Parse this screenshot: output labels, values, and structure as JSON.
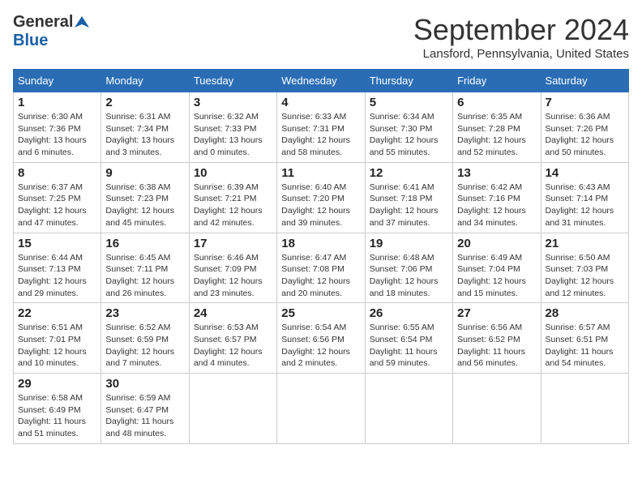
{
  "header": {
    "logo_general": "General",
    "logo_blue": "Blue",
    "month_title": "September 2024",
    "location": "Lansford, Pennsylvania, United States"
  },
  "calendar": {
    "days_of_week": [
      "Sunday",
      "Monday",
      "Tuesday",
      "Wednesday",
      "Thursday",
      "Friday",
      "Saturday"
    ],
    "weeks": [
      [
        {
          "day": "1",
          "sunrise": "6:30 AM",
          "sunset": "7:36 PM",
          "daylight": "13 hours and 6 minutes."
        },
        {
          "day": "2",
          "sunrise": "6:31 AM",
          "sunset": "7:34 PM",
          "daylight": "13 hours and 3 minutes."
        },
        {
          "day": "3",
          "sunrise": "6:32 AM",
          "sunset": "7:33 PM",
          "daylight": "13 hours and 0 minutes."
        },
        {
          "day": "4",
          "sunrise": "6:33 AM",
          "sunset": "7:31 PM",
          "daylight": "12 hours and 58 minutes."
        },
        {
          "day": "5",
          "sunrise": "6:34 AM",
          "sunset": "7:30 PM",
          "daylight": "12 hours and 55 minutes."
        },
        {
          "day": "6",
          "sunrise": "6:35 AM",
          "sunset": "7:28 PM",
          "daylight": "12 hours and 52 minutes."
        },
        {
          "day": "7",
          "sunrise": "6:36 AM",
          "sunset": "7:26 PM",
          "daylight": "12 hours and 50 minutes."
        }
      ],
      [
        {
          "day": "8",
          "sunrise": "6:37 AM",
          "sunset": "7:25 PM",
          "daylight": "12 hours and 47 minutes."
        },
        {
          "day": "9",
          "sunrise": "6:38 AM",
          "sunset": "7:23 PM",
          "daylight": "12 hours and 45 minutes."
        },
        {
          "day": "10",
          "sunrise": "6:39 AM",
          "sunset": "7:21 PM",
          "daylight": "12 hours and 42 minutes."
        },
        {
          "day": "11",
          "sunrise": "6:40 AM",
          "sunset": "7:20 PM",
          "daylight": "12 hours and 39 minutes."
        },
        {
          "day": "12",
          "sunrise": "6:41 AM",
          "sunset": "7:18 PM",
          "daylight": "12 hours and 37 minutes."
        },
        {
          "day": "13",
          "sunrise": "6:42 AM",
          "sunset": "7:16 PM",
          "daylight": "12 hours and 34 minutes."
        },
        {
          "day": "14",
          "sunrise": "6:43 AM",
          "sunset": "7:14 PM",
          "daylight": "12 hours and 31 minutes."
        }
      ],
      [
        {
          "day": "15",
          "sunrise": "6:44 AM",
          "sunset": "7:13 PM",
          "daylight": "12 hours and 29 minutes."
        },
        {
          "day": "16",
          "sunrise": "6:45 AM",
          "sunset": "7:11 PM",
          "daylight": "12 hours and 26 minutes."
        },
        {
          "day": "17",
          "sunrise": "6:46 AM",
          "sunset": "7:09 PM",
          "daylight": "12 hours and 23 minutes."
        },
        {
          "day": "18",
          "sunrise": "6:47 AM",
          "sunset": "7:08 PM",
          "daylight": "12 hours and 20 minutes."
        },
        {
          "day": "19",
          "sunrise": "6:48 AM",
          "sunset": "7:06 PM",
          "daylight": "12 hours and 18 minutes."
        },
        {
          "day": "20",
          "sunrise": "6:49 AM",
          "sunset": "7:04 PM",
          "daylight": "12 hours and 15 minutes."
        },
        {
          "day": "21",
          "sunrise": "6:50 AM",
          "sunset": "7:03 PM",
          "daylight": "12 hours and 12 minutes."
        }
      ],
      [
        {
          "day": "22",
          "sunrise": "6:51 AM",
          "sunset": "7:01 PM",
          "daylight": "12 hours and 10 minutes."
        },
        {
          "day": "23",
          "sunrise": "6:52 AM",
          "sunset": "6:59 PM",
          "daylight": "12 hours and 7 minutes."
        },
        {
          "day": "24",
          "sunrise": "6:53 AM",
          "sunset": "6:57 PM",
          "daylight": "12 hours and 4 minutes."
        },
        {
          "day": "25",
          "sunrise": "6:54 AM",
          "sunset": "6:56 PM",
          "daylight": "12 hours and 2 minutes."
        },
        {
          "day": "26",
          "sunrise": "6:55 AM",
          "sunset": "6:54 PM",
          "daylight": "11 hours and 59 minutes."
        },
        {
          "day": "27",
          "sunrise": "6:56 AM",
          "sunset": "6:52 PM",
          "daylight": "11 hours and 56 minutes."
        },
        {
          "day": "28",
          "sunrise": "6:57 AM",
          "sunset": "6:51 PM",
          "daylight": "11 hours and 54 minutes."
        }
      ],
      [
        {
          "day": "29",
          "sunrise": "6:58 AM",
          "sunset": "6:49 PM",
          "daylight": "11 hours and 51 minutes."
        },
        {
          "day": "30",
          "sunrise": "6:59 AM",
          "sunset": "6:47 PM",
          "daylight": "11 hours and 48 minutes."
        },
        {
          "day": "",
          "sunrise": "",
          "sunset": "",
          "daylight": ""
        },
        {
          "day": "",
          "sunrise": "",
          "sunset": "",
          "daylight": ""
        },
        {
          "day": "",
          "sunrise": "",
          "sunset": "",
          "daylight": ""
        },
        {
          "day": "",
          "sunrise": "",
          "sunset": "",
          "daylight": ""
        },
        {
          "day": "",
          "sunrise": "",
          "sunset": "",
          "daylight": ""
        }
      ]
    ]
  }
}
